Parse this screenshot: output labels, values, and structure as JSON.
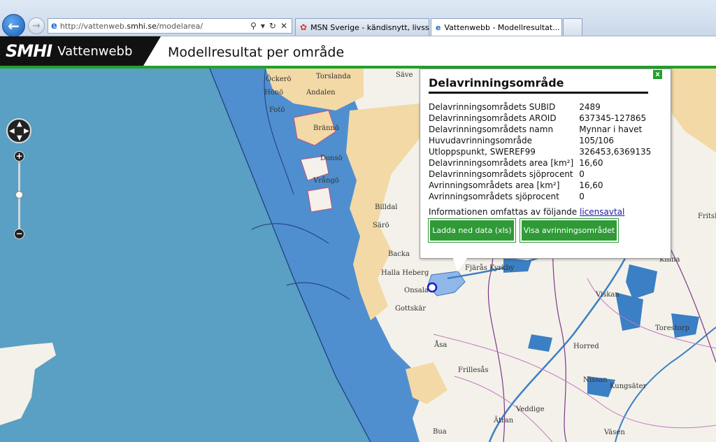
{
  "browser": {
    "url_prefix": "http://vattenweb.",
    "url_domain": "smhi.se",
    "url_path": "/modelarea/",
    "tabs": [
      {
        "label": "MSN Sverige - kändisnytt, livss..."
      },
      {
        "label": "Vattenwebb - Modellresultat...",
        "close": "×"
      }
    ]
  },
  "header": {
    "logo": "SMHI",
    "site_name": "Vattenwebb",
    "page_title": "Modellresultat per område"
  },
  "map": {
    "places": [
      "Öckerö",
      "Torslanda",
      "Hönö",
      "Andalen",
      "Fotö",
      "Brännö",
      "Donsö",
      "Vrångö",
      "Billdal",
      "Särö",
      "Backa",
      "Halla Heberg",
      "Onsala",
      "Gottskär",
      "Fjärås Kyrkby",
      "Åsa",
      "Frillesås",
      "Horred",
      "Kungsäter",
      "Veddige",
      "Torestorp",
      "Kinna",
      "Fritsla",
      "Bua",
      "Väsen",
      "Viskan",
      "Nissan",
      "Ätran",
      "Säve"
    ]
  },
  "popup": {
    "close": "x",
    "title": "Delavrinningsområde",
    "rows": [
      {
        "label": "Delavrinningsområdets SUBID",
        "value": "2489"
      },
      {
        "label": "Delavrinningsområdets AROID",
        "value": "637345-127865"
      },
      {
        "label": "Delavrinningsområdets namn",
        "value": "Mynnar i havet"
      },
      {
        "label": "Huvudavrinningsområde",
        "value": "105/106"
      },
      {
        "label": "Utloppspunkt, SWEREF99",
        "value": "326453,6369135"
      },
      {
        "label": "Delavrinningsområdets area [km²]",
        "value": "16,60"
      },
      {
        "label": "Delavrinningsområdets sjöprocent",
        "value": "0"
      },
      {
        "label": "Avrinningsområdets area [km²]",
        "value": "16,60"
      },
      {
        "label": "Avrinningsområdets sjöprocent",
        "value": "0"
      }
    ],
    "license_text": "Informationen omfattas av följande ",
    "license_link": "licensavtal",
    "download_button": "Ladda ned data (xls)",
    "show_button": "Visa avrinningsområdet"
  },
  "colors": {
    "accent": "#22a12a",
    "sea": "#5a9fc4",
    "coastal_sea": "#4f8fcf",
    "land": "#f4f1ea",
    "urban": "#f3d9a6"
  }
}
